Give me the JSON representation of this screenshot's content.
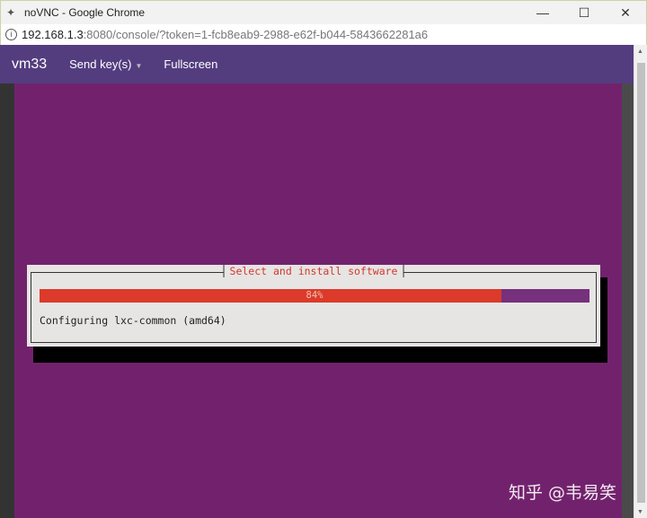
{
  "window": {
    "title": "noVNC - Google Chrome",
    "controls": [
      "minimize",
      "maximize",
      "close"
    ]
  },
  "address": {
    "host": "192.168.1.3",
    "rest": ":8080/console/?token=1-fcb8eab9-2988-e62f-b044-5843662281a6"
  },
  "nav": {
    "brand": "vm33",
    "send_keys": "Send key(s)",
    "fullscreen": "Fullscreen"
  },
  "dialog": {
    "title": "Select and install software",
    "progress_percent": 84,
    "progress_label": "84%",
    "status": "Configuring lxc-common (amd64)"
  },
  "colors": {
    "navbar": "#533d7f",
    "console_bg": "#72226d",
    "progress_fill": "#dc3a2a"
  },
  "watermark": "知乎 @韦易笑"
}
